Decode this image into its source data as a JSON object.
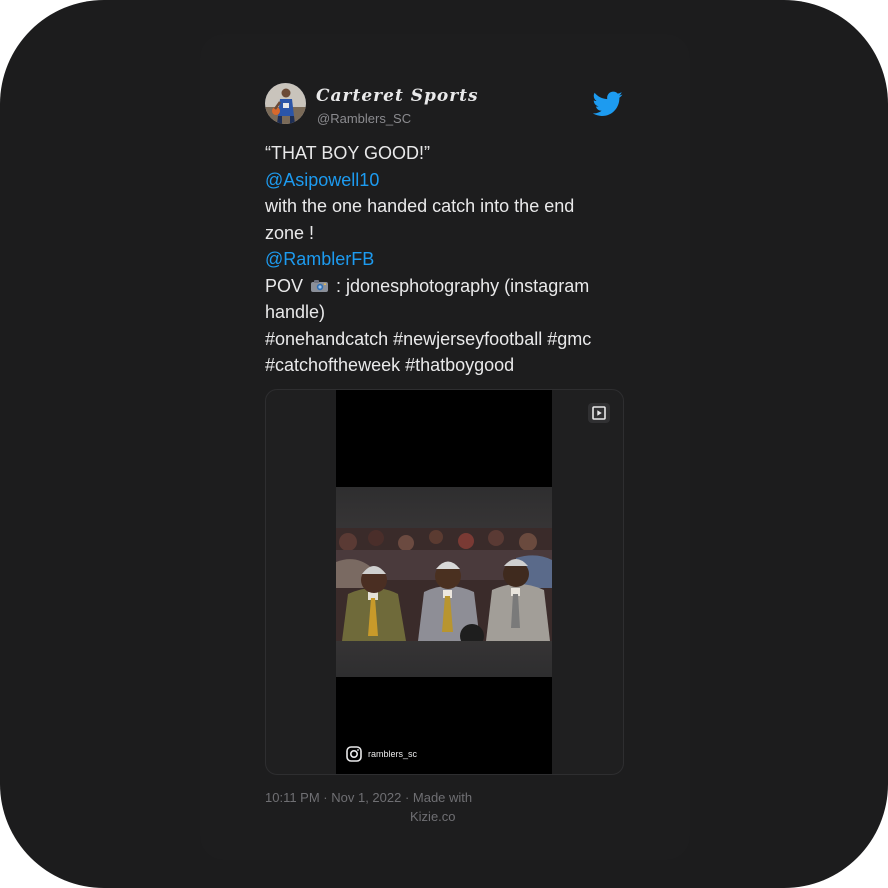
{
  "account": {
    "display_name": "Carteret Sports",
    "handle": "@Ramblers_SC",
    "avatar_icon": "basketball-player-avatar-icon"
  },
  "brand": {
    "icon": "twitter-bird-icon",
    "color": "#1d9bf0"
  },
  "tweet": {
    "line1": "“THAT BOY GOOD!”",
    "mention1": "@Asipowell10",
    "line3": "with the one handed catch into the end",
    "line4": "zone !",
    "mention2": "@RamblerFB",
    "pov_prefix": "POV",
    "pov_icon": "camera-icon",
    "pov_text": ": jdonesphotography (instagram",
    "line7": "handle)",
    "hashtags1": "#onehandcatch #newjerseyfootball #gmc",
    "hashtags2": "#catchoftheweek #thatboygood"
  },
  "media": {
    "type": "video",
    "play_icon": "play-icon",
    "watermark_icon": "instagram-icon",
    "watermark": "ramblers_sc"
  },
  "footer": {
    "timestamp": "10:11 PM · Nov 1, 2022 · Made with",
    "credit": "Kizie.co"
  },
  "colors": {
    "background": "#1c1c1d",
    "text": "#e9e9ea",
    "secondary_text": "#8b8b8f",
    "link": "#1d9bf0"
  }
}
